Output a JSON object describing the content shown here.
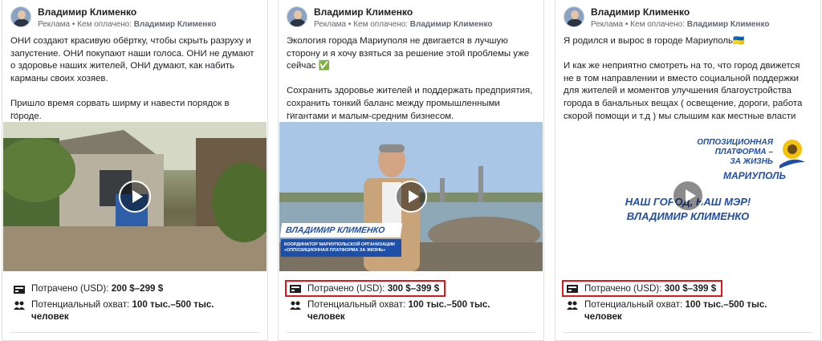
{
  "cards": [
    {
      "author": "Владимир Клименко",
      "ad_label": "Реклама",
      "paid_prefix": " • Кем оплачено: ",
      "payer": "Владимир Клименко",
      "text": "ОНИ создают красивую обёртку, чтобы скрыть разруху и запустение. ОНИ покупают наши голоса. ОНИ не думают о здоровье наших жителей, ОНИ думают, как набить карманы своих хозяев.\n\nПришло время сорвать ширму и навести порядок в городе.",
      "ellipsis": "...",
      "spend_label": "Потрачено (USD): ",
      "spend_value": "200 $–299 $",
      "spend_highlighted": false,
      "reach_label": "Потенциальный охват: ",
      "reach_value": "100 тыс.–500 тыс. человек"
    },
    {
      "author": "Владимир Клименко",
      "ad_label": "Реклама",
      "paid_prefix": " • Кем оплачено: ",
      "payer": "Владимир Клименко",
      "text": "Экология города Мариуполя не двигается в лучшую сторону и я хочу взяться за решение этой проблемы уже сейчас ✅\n\nСохранить здоровье жителей и поддержать предприятия, сохранить тонкий баланс между промышленными гигантами и малым-средним бизнесом.",
      "ellipsis": "...",
      "spend_label": "Потрачено (USD): ",
      "spend_value": "300 $–399 $",
      "spend_highlighted": true,
      "reach_label": "Потенциальный охват: ",
      "reach_value": "100 тыс.–500 тыс. человек",
      "video_overlay": {
        "name": "ВЛАДИМИР КЛИМЕНКО",
        "role": "КООРДИНАТОР МАРИУПОЛЬСКОЙ ОРГАНИЗАЦИИ «ОППОЗИЦИОННАЯ ПЛАТФОРМА ЗА ЖИЗНЬ»"
      }
    },
    {
      "author": "Владимир Клименко",
      "ad_label": "Реклама",
      "paid_prefix": " • Кем оплачено: ",
      "payer": "Владимир Клименко",
      "text": "Я родился и вырос в городе Мариуполь🇺🇦\n\nИ как же неприятно смотреть на то, что город движется не в том направлении и вместо социальной поддержки для жителей и моментов улучшения благоустройства города в банальных вещах ( освещение, дороги, работа скорой помощи и т.д ) мы слышим как местные власти хотят фонтан...",
      "ellipsis": "",
      "spend_label": "Потрачено (USD): ",
      "spend_value": "300 $–399 $",
      "spend_highlighted": true,
      "reach_label": "Потенциальный охват: ",
      "reach_value": "100 тыс.–500 тыс. человек",
      "poster": {
        "party_line1": "ОППОЗИЦИОННАЯ",
        "party_line2": "ПЛАТФОРМА –",
        "party_line3": "ЗА ЖИЗНЬ",
        "city": "МАРИУПОЛЬ",
        "slogan1": "НАШ ГОРОД, НАШ МЭР!",
        "slogan2": "ВЛАДИМИР КЛИМЕНКО"
      }
    }
  ],
  "colors": {
    "highlight_border": "#e0161b",
    "poster_blue": "#1f4fa8",
    "overlay_blue": "#1e4fa8"
  }
}
